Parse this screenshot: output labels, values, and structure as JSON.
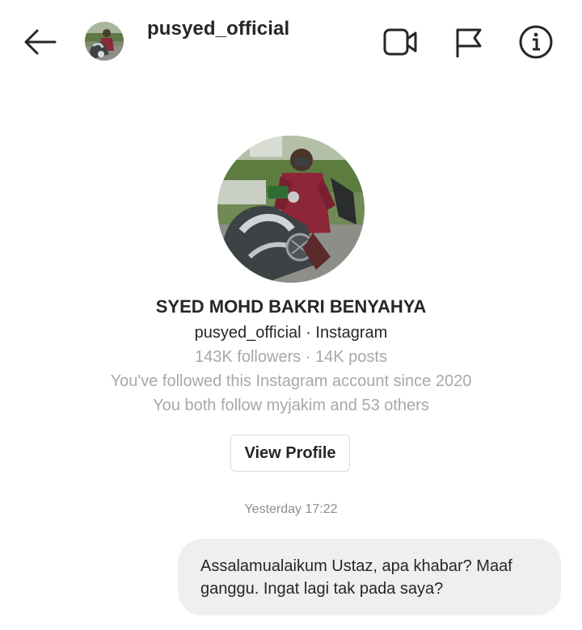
{
  "header": {
    "username": "pusyed_official",
    "back_icon": "arrow-left-icon",
    "video_icon": "video-call-icon",
    "flag_icon": "flag-icon",
    "info_icon": "info-icon"
  },
  "profile": {
    "full_name": "SYED MOHD BAKRI BENYAHYA",
    "subline": "pusyed_official · Instagram",
    "stats": "143K followers · 14K posts",
    "followed_since": "You've followed this Instagram account since 2020",
    "mutual": "You both follow myjakim and 53 others",
    "view_profile_label": "View Profile"
  },
  "conversation": {
    "timestamp": "Yesterday 17:22",
    "messages": [
      {
        "from": "me",
        "lines": [
          "Assalamualaikum Ustaz, apa khabar? Maaf",
          "ganggu. Ingat lagi tak pada saya?"
        ]
      }
    ]
  },
  "colors": {
    "text_primary": "#262626",
    "text_secondary": "#a8a8a8",
    "timestamp": "#8e8e8e",
    "bubble_bg": "#efefef",
    "button_border": "#dbdbdb",
    "background": "#ffffff"
  }
}
